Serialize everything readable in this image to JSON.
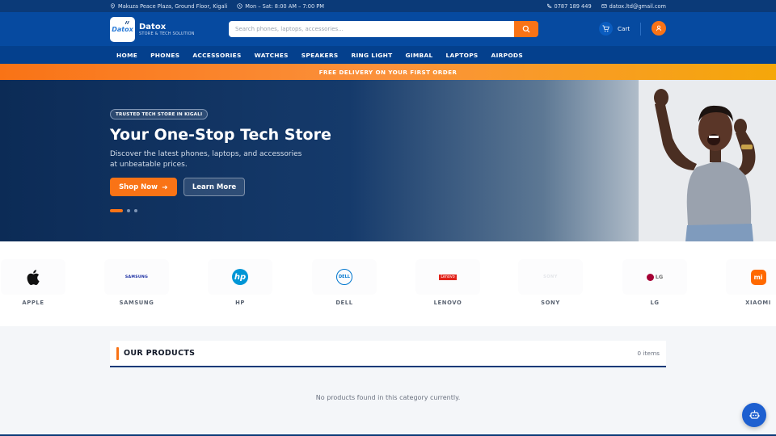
{
  "topbar": {
    "address": "Makuza Peace Plaza, Ground Floor, Kigali",
    "hours": "Mon – Sat: 8:00 AM – 7:00 PM",
    "phone": "0787 189 449",
    "email": "datox.ltd@gmail.com"
  },
  "header": {
    "logo_text": "Datox",
    "brand_name": "Datox",
    "brand_tagline": "STORE & TECH SOLUTION",
    "search_placeholder": "Search phones, laptops, accessories...",
    "cart_label": "Cart"
  },
  "nav": {
    "items": [
      {
        "label": "HOME"
      },
      {
        "label": "PHONES"
      },
      {
        "label": "ACCESSORIES"
      },
      {
        "label": "WATCHES"
      },
      {
        "label": "SPEAKERS"
      },
      {
        "label": "RING LIGHT"
      },
      {
        "label": "GIMBAL"
      },
      {
        "label": "LAPTOPS"
      },
      {
        "label": "AIRPODS"
      }
    ]
  },
  "promo": {
    "text": "FREE DELIVERY ON YOUR FIRST ORDER"
  },
  "hero": {
    "badge": "TRUSTED TECH STORE IN KIGALI",
    "title": "Your One-Stop Tech Store",
    "subtitle": "Discover the latest phones, laptops, and accessories at unbeatable prices.",
    "primary_cta": "Shop Now",
    "secondary_cta": "Learn More",
    "slide_count": 3,
    "active_slide": 1
  },
  "brands": {
    "items": [
      {
        "label": "APPLE",
        "logo_text": ""
      },
      {
        "label": "SAMSUNG",
        "logo_text": "SAMSUNG"
      },
      {
        "label": "HP",
        "logo_text": "hp"
      },
      {
        "label": "DELL",
        "logo_text": "DELL"
      },
      {
        "label": "LENOVO",
        "logo_text": "Lenovo"
      },
      {
        "label": "SONY",
        "logo_text": "SONY"
      },
      {
        "label": "LG",
        "logo_text": "LG"
      },
      {
        "label": "XIAOMI",
        "logo_text": "mi"
      }
    ]
  },
  "products": {
    "title": "OUR PRODUCTS",
    "count": "0 items",
    "empty_message": "No products found in this category currently."
  },
  "colors": {
    "primary_dark": "#0b3a78",
    "primary": "#064aa0",
    "accent": "#f97316"
  }
}
